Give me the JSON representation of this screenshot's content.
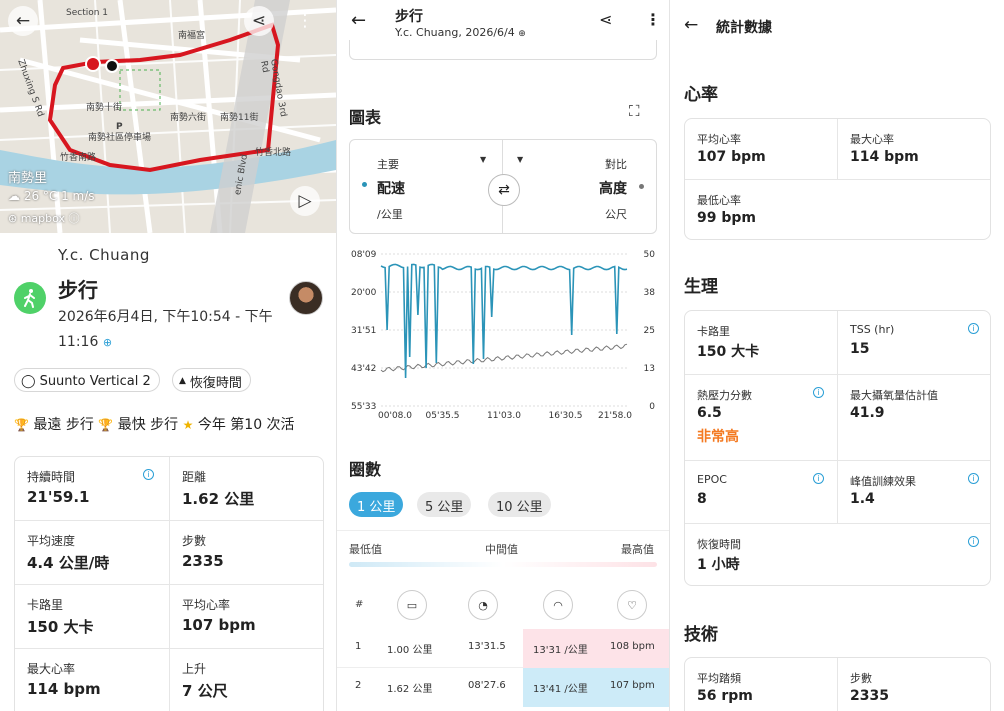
{
  "map": {
    "labels": {
      "section1": "Section 1",
      "nanfu": "南福宮",
      "nanshi10": "南勢十街",
      "nanshi6": "南勢六街",
      "nanshi11": "南勢11街",
      "parking": "南勢社區停車場",
      "zhuxiang": "竹香南路",
      "zhuxiangN": "竹香北路",
      "gongdao": "Gongdao 3rd Rd",
      "zhuxing": "Zhuxing S Rd",
      "scenic": "enic Blvd",
      "p": "P"
    },
    "place": "南勢里",
    "weather": "26 °C  1 m/s",
    "attrib": "mapbox"
  },
  "activity": {
    "user": "Y.c. Chuang",
    "title": "步行",
    "time": "2026年6月4日, 下午10:54 - 下午11:16",
    "device": "Suunto Vertical 2",
    "recovery_chip": "恢復時間",
    "achievements": [
      {
        "label": "最遠 步行"
      },
      {
        "label": "最快 步行"
      },
      {
        "label": "今年 第10 次活"
      }
    ],
    "stats": [
      {
        "label": "持續時間",
        "value": "21'59.1"
      },
      {
        "label": "距離",
        "value": "1.62 公里"
      },
      {
        "label": "平均速度",
        "value": "4.4 公里/時"
      },
      {
        "label": "步數",
        "value": "2335"
      },
      {
        "label": "卡路里",
        "value": "150 大卡"
      },
      {
        "label": "平均心率",
        "value": "107 bpm"
      },
      {
        "label": "最大心率",
        "value": "114 bpm"
      },
      {
        "label": "上升",
        "value": "7 公尺"
      }
    ]
  },
  "detail": {
    "title": "步行",
    "subtitle": "Y.c. Chuang, 2026/6/4",
    "chart_section": "圖表",
    "primary_label": "主要",
    "primary_value": "配速",
    "primary_unit": "/公里",
    "compare_label": "對比",
    "compare_value": "高度",
    "compare_unit": "公尺",
    "laps_section": "圈數",
    "lap_tabs": [
      "1 公里",
      "5 公里",
      "10 公里"
    ],
    "legend": {
      "min": "最低值",
      "mid": "中間值",
      "max": "最高值"
    },
    "lap_col_hash": "#",
    "laps": [
      {
        "n": "1",
        "dist": "1.00 公里",
        "time": "13'31.5",
        "pace": "13'31 /公里",
        "hr": "108 bpm"
      },
      {
        "n": "2",
        "dist": "1.62 公里",
        "time": "08'27.6",
        "pace": "13'41 /公里",
        "hr": "107 bpm"
      }
    ]
  },
  "chart_data": {
    "type": "line",
    "x_ticks": [
      "00'08.0",
      "05'35.5",
      "11'03.0",
      "16'30.5",
      "21'58.0"
    ],
    "y_left_ticks": [
      "08'09",
      "20'00",
      "31'51",
      "43'42",
      "55'33"
    ],
    "y_right_ticks": [
      "50",
      "38",
      "25",
      "13",
      "0"
    ],
    "series": [
      {
        "name": "配速",
        "color": "#2b94b8"
      },
      {
        "name": "高度",
        "color": "#777777"
      }
    ]
  },
  "stats_page": {
    "title": "統計數據",
    "hr_section": "心率",
    "hr": [
      {
        "label": "平均心率",
        "value": "107 bpm"
      },
      {
        "label": "最大心率",
        "value": "114 bpm"
      },
      {
        "label": "最低心率",
        "value": "99 bpm"
      }
    ],
    "phys_section": "生理",
    "phys": [
      {
        "label": "卡路里",
        "value": "150 大卡"
      },
      {
        "label": "TSS (hr)",
        "value": "15"
      },
      {
        "label": "熱壓力分數",
        "value": "6.5",
        "sub": "非常高"
      },
      {
        "label": "最大攝氧量估計值",
        "value": "41.9"
      },
      {
        "label": "EPOC",
        "value": "8"
      },
      {
        "label": "峰值訓練效果",
        "value": "1.4"
      },
      {
        "label": "恢復時間",
        "value": "1 小時"
      }
    ],
    "tech_section": "技術",
    "tech": [
      {
        "label": "平均踏頻",
        "value": "56 rpm"
      },
      {
        "label": "步數",
        "value": "2335"
      }
    ]
  }
}
